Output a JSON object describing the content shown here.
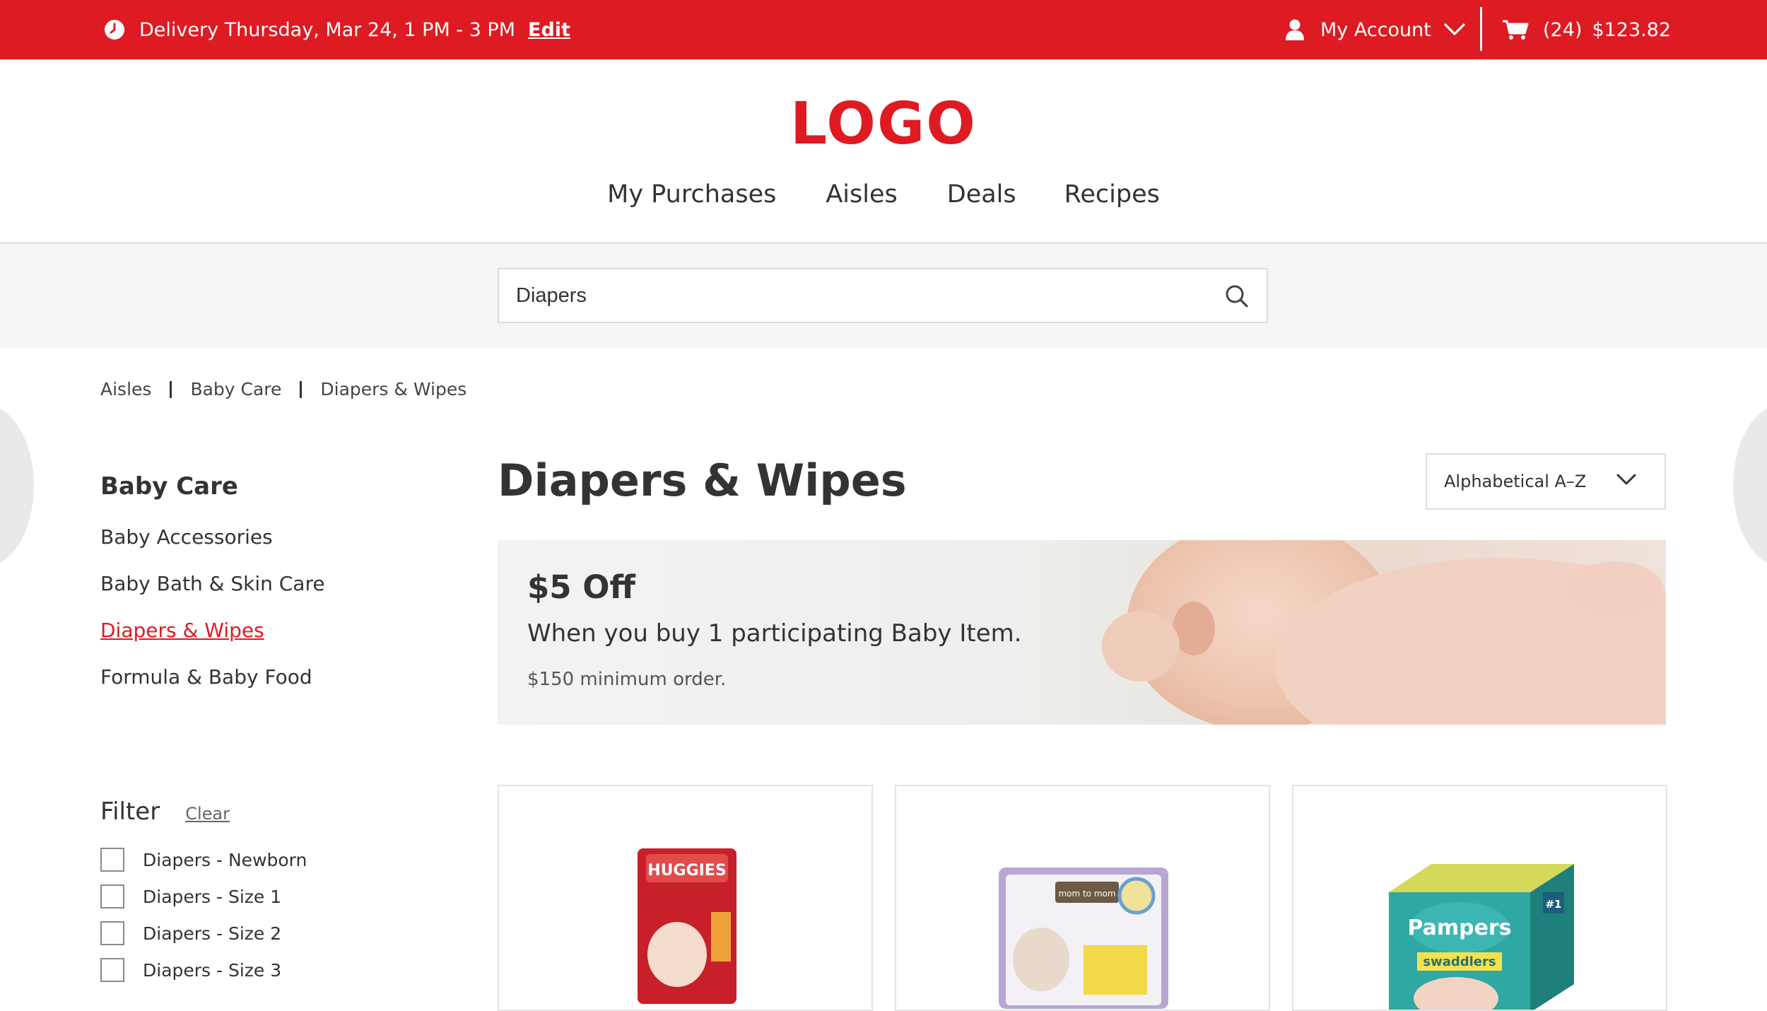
{
  "topbar": {
    "delivery_text": "Delivery Thursday, Mar 24, 1 PM - 3 PM",
    "edit_label": "Edit",
    "account_label": "My Account",
    "cart_count": "(24)",
    "cart_total": "$123.82",
    "background_color": "#de1b22"
  },
  "header": {
    "logo_text": "LOGO",
    "nav": [
      "My Purchases",
      "Aisles",
      "Deals",
      "Recipes"
    ]
  },
  "search": {
    "value": "Diapers"
  },
  "breadcrumb": [
    "Aisles",
    "Baby Care",
    "Diapers & Wipes"
  ],
  "sidebar": {
    "category_title": "Baby Care",
    "items": [
      "Baby Accessories",
      "Baby Bath & Skin Care",
      "Diapers & Wipes",
      "Formula & Baby Food"
    ],
    "active_item": "Diapers & Wipes"
  },
  "filter": {
    "title": "Filter",
    "clear_label": "Clear",
    "options": [
      "Diapers - Newborn",
      "Diapers - Size 1",
      "Diapers - Size 2",
      "Diapers - Size 3"
    ]
  },
  "main": {
    "title": "Diapers & Wipes",
    "sort_selected": "Alphabetical A–Z"
  },
  "promo": {
    "title": "$5 Off",
    "subtitle": "When you buy 1 participating Baby Item.",
    "fineprint": "$150 minimum order."
  },
  "products": [
    {
      "brand": "HUGGIES"
    },
    {
      "brand": "mom to mom"
    },
    {
      "brand": "Pampers",
      "sub": "swaddlers",
      "badge": "#1"
    }
  ]
}
